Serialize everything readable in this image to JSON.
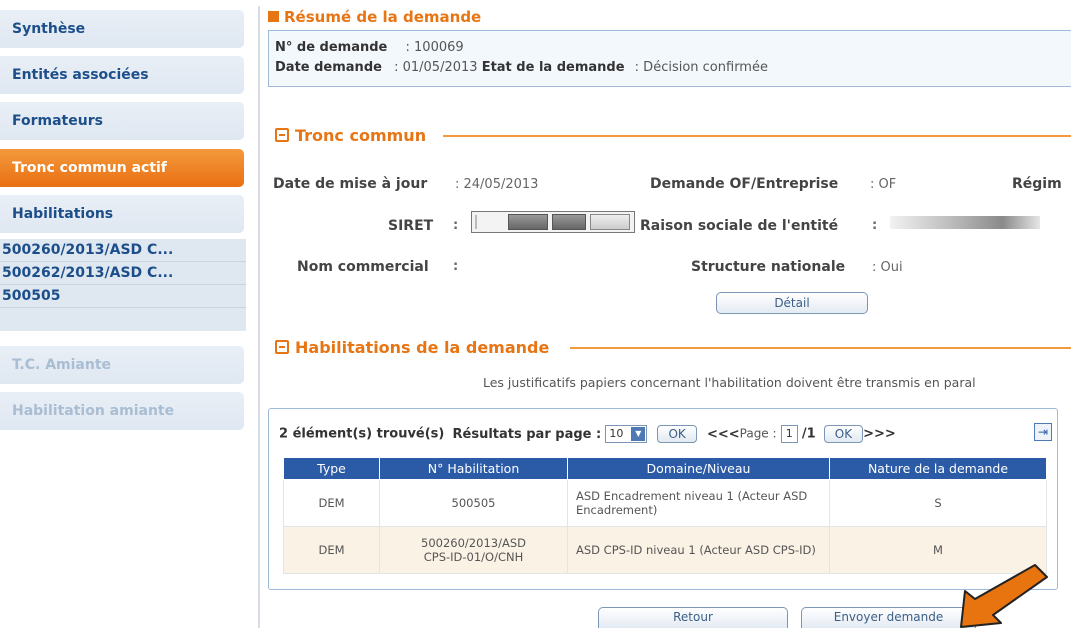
{
  "sidebar": {
    "items": [
      {
        "label": "Synthèse"
      },
      {
        "label": "Entités associées"
      },
      {
        "label": "Formateurs"
      },
      {
        "label": "Tronc commun actif"
      },
      {
        "label": "Habilitations"
      }
    ],
    "sub_items": [
      "500260/2013/ASD C...",
      "500262/2013/ASD C...",
      "500505"
    ],
    "disabled_items": [
      "T.C. Amiante",
      "Habilitation amiante"
    ],
    "active_color": "#e96f12"
  },
  "summary": {
    "title": "Résumé de la demande",
    "num_label": "N° de demande",
    "num_value": ": 100069",
    "date_label": "Date demande",
    "date_value": ": 01/05/2013",
    "etat_label": "Etat de la demande",
    "etat_value": ": Décision confirmée"
  },
  "tronc": {
    "title": "Tronc commun",
    "maj_label": "Date de mise à jour",
    "maj_value": ": 24/05/2013",
    "demande_label": "Demande OF/Entreprise",
    "demande_value": ": OF",
    "regime_label": "Régim",
    "siret_label": "SIRET",
    "siret_colon": ":",
    "raison_label": "Raison sociale de l'entité",
    "raison_colon": ":",
    "nom_label": "Nom commercial",
    "nom_colon": ":",
    "structure_label": "Structure nationale",
    "structure_value": ": Oui",
    "detail_button": "Détail"
  },
  "habilitations": {
    "title": "Habilitations de la demande",
    "note": "Les justificatifs papiers concernant l'habilitation doivent être transmis en paral"
  },
  "table": {
    "count_text": "2 élément(s) trouvé(s)",
    "per_page_label": "Résultats par page :",
    "per_page_value": "10",
    "ok_label": "OK",
    "prev_text": "<<<",
    "page_label": "Page :",
    "page_value": "1",
    "page_total": "/1",
    "next_text": ">>>",
    "export_icon": "export-icon",
    "headers": [
      "Type",
      "N° Habilitation",
      "Domaine/Niveau",
      "Nature de la demande"
    ],
    "rows": [
      {
        "type": "DEM",
        "num": "500505",
        "domaine": "ASD Encadrement niveau 1 (Acteur ASD Encadrement)",
        "nature": "S"
      },
      {
        "type": "DEM",
        "num": "500260/2013/ASD CPS-ID-01/O/CNH",
        "domaine": "ASD CPS-ID niveau 1 (Acteur ASD CPS-ID)",
        "nature": "M"
      }
    ],
    "header_color": "#2b5aa6"
  },
  "footer": {
    "retour_button": "Retour",
    "envoyer_button": "Envoyer demande"
  },
  "annotation": {
    "icon": "arrow-pointer-icon",
    "color": "#e8740f"
  }
}
